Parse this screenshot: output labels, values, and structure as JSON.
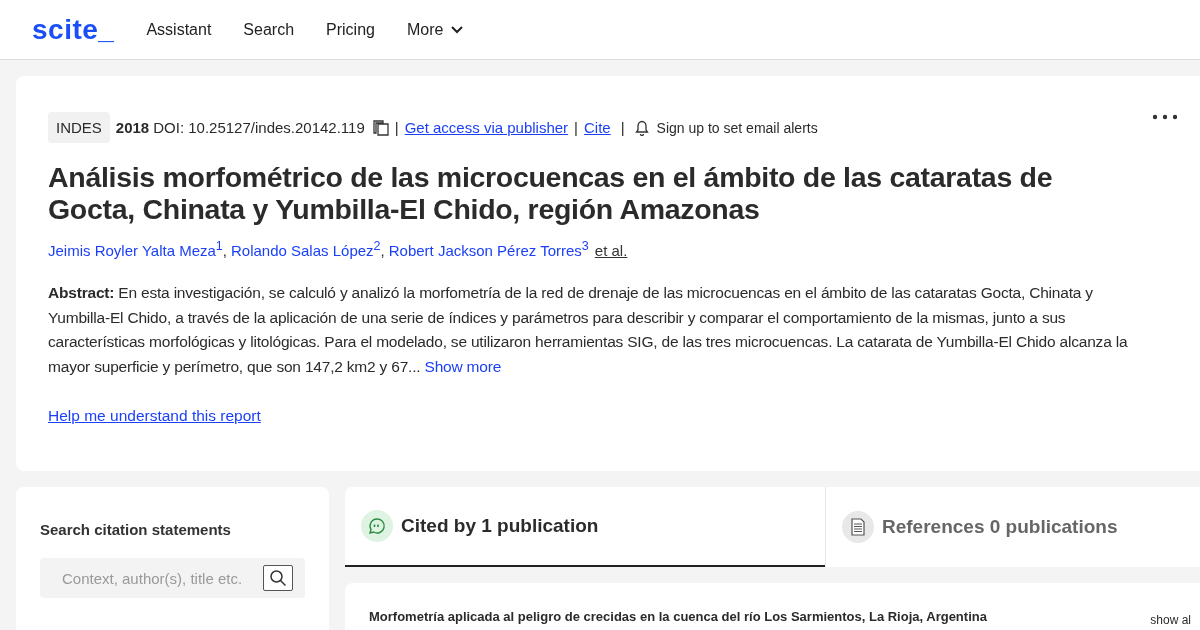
{
  "nav": {
    "logo": "scite_",
    "links": [
      {
        "label": "Assistant",
        "kind": "link"
      },
      {
        "label": "Search",
        "kind": "link"
      },
      {
        "label": "Pricing",
        "kind": "link"
      },
      {
        "label": "More",
        "kind": "dropdown"
      }
    ]
  },
  "paper": {
    "journal": "INDES",
    "year": "2018",
    "doi": "DOI: 10.25127/indes.20142.119",
    "access_link": "Get access via publisher",
    "cite_link": "Cite",
    "alerts": "Sign up to set email alerts",
    "title": "Análisis morfométrico de las microcuencas en el ámbito de las cataratas de Gocta, Chinata y Yumbilla-El Chido, región Amazonas",
    "separators": [
      "|",
      "|",
      "|"
    ],
    "authors": [
      {
        "name": "Jeimis Royler Yalta Meza$^{1}$",
        "after": ","
      },
      {
        "name": "Rolando Salas López$^{2}$",
        "after": ","
      },
      {
        "name": "Robert Jackson Pérez Torres$^{3}$"
      }
    ],
    "et_al": "et al.",
    "abstract": "**Abstract:** En esta investigación, se calculó y analizó la morfometría de la red de drenaje de las microcuencas en el ámbito de las cataratas Gocta, Chinata y Yumbilla-El Chido, a través de la aplicación de una serie de índices y parámetros para describir y comparar el comportamiento de la mismas, junto a sus características morfológicas y litológicas. Para el modelado, se utilizaron herramientas SIG, de las tres microcuencas. La catarata de Yumbilla-El Chido alcanza la mayor superficie y perímetro, que son 147,2 km2 y 67...",
    "show_more": "Show more",
    "help_link": "Help me understand this report"
  },
  "search_panel": {
    "heading": "Search citation statements",
    "placeholder": "Context, author(s), title etc."
  },
  "tabs": [
    {
      "label": "Cited by 1 publication",
      "kind": "cited",
      "selected": true
    },
    {
      "label": "References 0 publications",
      "kind": "references",
      "selected": false
    }
  ],
  "results": [
    {
      "title": "Morfometría aplicada al peligro de crecidas en la cuenca del río Los Sarmientos, La Rioja, Argentina",
      "action": "show al"
    }
  ]
}
